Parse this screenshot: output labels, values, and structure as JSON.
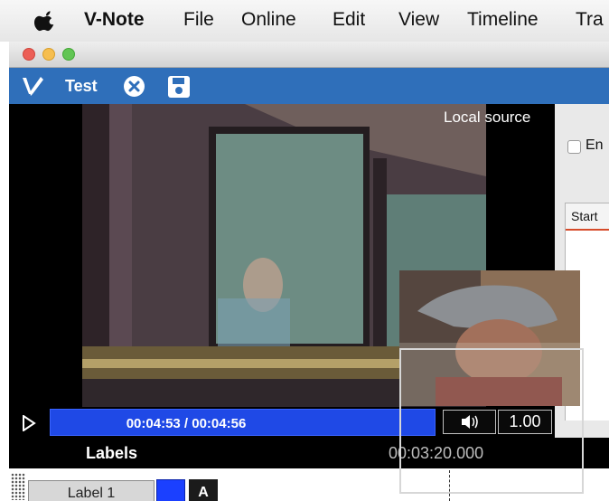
{
  "menu": {
    "app_name": "V-Note",
    "items": [
      "File",
      "Online",
      "Edit",
      "View",
      "Timeline",
      "Tra"
    ]
  },
  "toolbar": {
    "title": "Test"
  },
  "video": {
    "source_label": "Local source",
    "time_display": "00:04:53 / 00:04:56",
    "progress": 0.99,
    "playback_rate": "1.00"
  },
  "timeline": {
    "header": "Labels",
    "timecode": "00:03:20.000"
  },
  "labels": [
    {
      "name": "Label 1",
      "shortcut": "A",
      "color": "#1b40ff"
    }
  ],
  "right_panel": {
    "checkbox_label": "En",
    "column_header": "Start"
  },
  "icons": {
    "apple": "apple-logo-icon",
    "app": "v-note-pen-icon",
    "close": "close-circle-icon",
    "save": "save-disk-icon",
    "play": "play-icon",
    "volume": "speaker-volume-icon"
  },
  "colors": {
    "toolbar": "#2f6fba",
    "seekbar": "#1f49e6",
    "selected_column": "#d64b2a"
  }
}
